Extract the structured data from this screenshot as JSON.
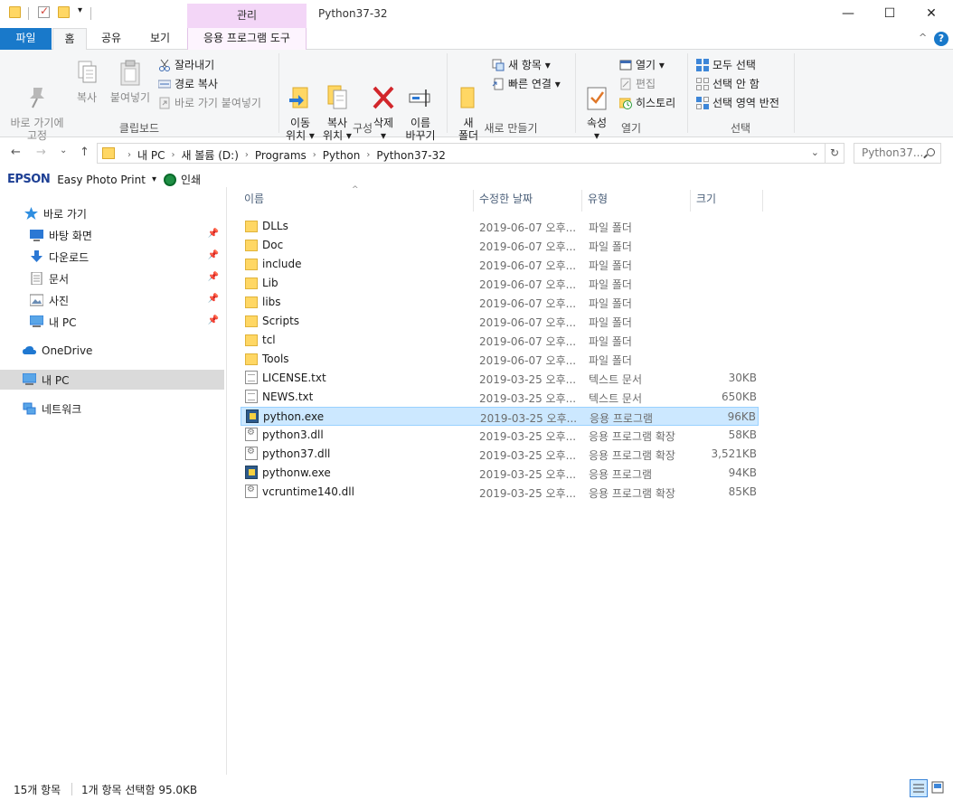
{
  "title_bar": {
    "window_title": "Python37-32",
    "manage_tab": "관리",
    "buttons": {
      "minimize": "—",
      "maximize": "☐",
      "close": "✕"
    }
  },
  "ribbon_tabs": {
    "file": "파일",
    "home": "홈",
    "share": "공유",
    "view": "보기",
    "app_tools": "응용 프로그램 도구",
    "collapse": "^",
    "help": "?"
  },
  "ribbon": {
    "clipboard": {
      "label": "클립보드",
      "pin_quick_access": "바로 가기에\n고정",
      "copy": "복사",
      "paste": "붙여넣기",
      "cut": "잘라내기",
      "copy_path": "경로 복사",
      "paste_shortcut": "바로 가기 붙여넣기"
    },
    "organize": {
      "label": "구성",
      "move_to": "이동\n위치 ▾",
      "copy_to": "복사\n위치 ▾",
      "delete": "삭제\n▾",
      "rename": "이름\n바꾸기"
    },
    "new": {
      "label": "새로 만들기",
      "new_folder": "새\n폴더",
      "new_item": "새 항목 ▾",
      "easy_access": "빠른 연결 ▾"
    },
    "open": {
      "label": "열기",
      "properties": "속성\n▾",
      "open": "열기 ▾",
      "edit": "편집",
      "history": "히스토리"
    },
    "select": {
      "label": "선택",
      "select_all": "모두 선택",
      "select_none": "선택 안 함",
      "invert": "선택 영역 반전"
    }
  },
  "navigation": {
    "back": "←",
    "forward": "→",
    "recent": "⌄",
    "up": "↑",
    "breadcrumbs": [
      "내 PC",
      "새 볼륨 (D:)",
      "Programs",
      "Python",
      "Python37-32"
    ],
    "dropdown": "⌄",
    "refresh": "↻",
    "search_placeholder": "Python37..."
  },
  "epson": {
    "logo": "EPSON",
    "app": "Easy Photo Print",
    "dropdown": "▾",
    "print": "인쇄"
  },
  "nav_pane": {
    "quick_access": "바로 가기",
    "items": [
      {
        "label": "바탕 화면",
        "icon": "desktop-icon",
        "pinned": true
      },
      {
        "label": "다운로드",
        "icon": "download-icon",
        "pinned": true
      },
      {
        "label": "문서",
        "icon": "document-icon",
        "pinned": true
      },
      {
        "label": "사진",
        "icon": "pictures-icon",
        "pinned": true
      },
      {
        "label": "내 PC",
        "icon": "computer-icon",
        "pinned": true
      }
    ],
    "onedrive": "OneDrive",
    "this_pc": "내 PC",
    "network": "네트워크"
  },
  "columns": {
    "name": "이름",
    "date": "수정한 날짜",
    "type": "유형",
    "size": "크기"
  },
  "files": [
    {
      "name": "DLLs",
      "date": "2019-06-07 오후...",
      "type": "파일 폴더",
      "size": "",
      "kind": "folder"
    },
    {
      "name": "Doc",
      "date": "2019-06-07 오후...",
      "type": "파일 폴더",
      "size": "",
      "kind": "folder"
    },
    {
      "name": "include",
      "date": "2019-06-07 오후...",
      "type": "파일 폴더",
      "size": "",
      "kind": "folder"
    },
    {
      "name": "Lib",
      "date": "2019-06-07 오후...",
      "type": "파일 폴더",
      "size": "",
      "kind": "folder"
    },
    {
      "name": "libs",
      "date": "2019-06-07 오후...",
      "type": "파일 폴더",
      "size": "",
      "kind": "folder"
    },
    {
      "name": "Scripts",
      "date": "2019-06-07 오후...",
      "type": "파일 폴더",
      "size": "",
      "kind": "folder"
    },
    {
      "name": "tcl",
      "date": "2019-06-07 오후...",
      "type": "파일 폴더",
      "size": "",
      "kind": "folder"
    },
    {
      "name": "Tools",
      "date": "2019-06-07 오후...",
      "type": "파일 폴더",
      "size": "",
      "kind": "folder"
    },
    {
      "name": "LICENSE.txt",
      "date": "2019-03-25 오후...",
      "type": "텍스트 문서",
      "size": "30KB",
      "kind": "doc"
    },
    {
      "name": "NEWS.txt",
      "date": "2019-03-25 오후...",
      "type": "텍스트 문서",
      "size": "650KB",
      "kind": "doc"
    },
    {
      "name": "python.exe",
      "date": "2019-03-25 오후...",
      "type": "응용 프로그램",
      "size": "96KB",
      "kind": "exe",
      "selected": true
    },
    {
      "name": "python3.dll",
      "date": "2019-03-25 오후...",
      "type": "응용 프로그램 확장",
      "size": "58KB",
      "kind": "dll"
    },
    {
      "name": "python37.dll",
      "date": "2019-03-25 오후...",
      "type": "응용 프로그램 확장",
      "size": "3,521KB",
      "kind": "dll"
    },
    {
      "name": "pythonw.exe",
      "date": "2019-03-25 오후...",
      "type": "응용 프로그램",
      "size": "94KB",
      "kind": "exe"
    },
    {
      "name": "vcruntime140.dll",
      "date": "2019-03-25 오후...",
      "type": "응용 프로그램 확장",
      "size": "85KB",
      "kind": "dll"
    }
  ],
  "status": {
    "count": "15개 항목",
    "selection": "1개 항목 선택함 95.0KB"
  },
  "colors": {
    "accent": "#1979ca",
    "selection_bg": "#cce8ff",
    "selection_border": "#99d1ff",
    "manage_tab": "#f3d6f7"
  }
}
